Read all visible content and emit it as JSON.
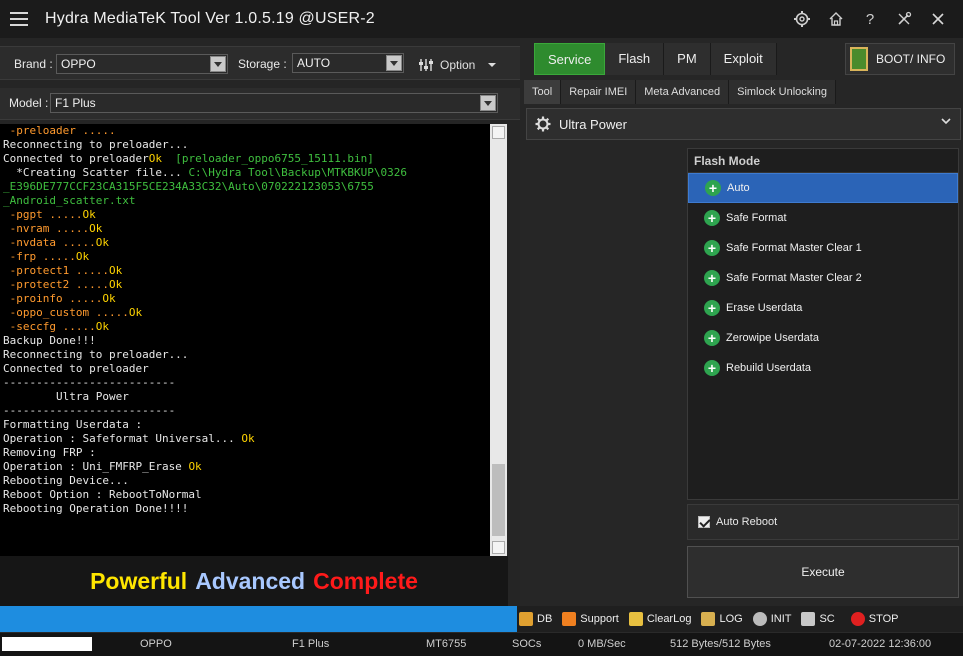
{
  "title": "Hydra MediaTeK Tool  Ver 1.0.5.19 @USER-2",
  "window_icons": [
    "settings-icon",
    "home-icon",
    "help-icon",
    "tools-icon",
    "close-icon"
  ],
  "left": {
    "brand_label": "Brand :",
    "brand_value": "OPPO",
    "storage_label": "Storage :",
    "storage_value": "AUTO",
    "option_label": "Option",
    "model_label": "Model :",
    "model_value": "F1 Plus"
  },
  "console_lines": [
    [
      {
        "t": " -preloader .....",
        "c": "o"
      }
    ],
    [
      {
        "t": "Reconnecting to preloader...",
        "c": "w"
      }
    ],
    [
      {
        "t": "Connected to preloader",
        "c": "w"
      },
      {
        "t": "Ok",
        "c": "y"
      },
      {
        "t": "  [preloader_oppo6755_15111.bin]",
        "c": "g"
      }
    ],
    [
      {
        "t": "  *Creating Scatter file... ",
        "c": "w"
      },
      {
        "t": "C:\\Hydra Tool\\Backup\\MTKBKUP\\0326",
        "c": "g"
      }
    ],
    [
      {
        "t": "_E396DE777CCF23CA315F5CE234A33C32\\Auto\\070222123053\\6755",
        "c": "g"
      }
    ],
    [
      {
        "t": "_Android_scatter.txt",
        "c": "g"
      }
    ],
    [
      {
        "t": " -pgpt .....",
        "c": "o"
      },
      {
        "t": "Ok",
        "c": "y"
      }
    ],
    [
      {
        "t": " -nvram .....",
        "c": "o"
      },
      {
        "t": "Ok",
        "c": "y"
      }
    ],
    [
      {
        "t": " -nvdata .....",
        "c": "o"
      },
      {
        "t": "Ok",
        "c": "y"
      }
    ],
    [
      {
        "t": " -frp .....",
        "c": "o"
      },
      {
        "t": "Ok",
        "c": "y"
      }
    ],
    [
      {
        "t": " -protect1 .....",
        "c": "o"
      },
      {
        "t": "Ok",
        "c": "y"
      }
    ],
    [
      {
        "t": " -protect2 .....",
        "c": "o"
      },
      {
        "t": "Ok",
        "c": "y"
      }
    ],
    [
      {
        "t": " -proinfo .....",
        "c": "o"
      },
      {
        "t": "Ok",
        "c": "y"
      }
    ],
    [
      {
        "t": " -oppo_custom .....",
        "c": "o"
      },
      {
        "t": "Ok",
        "c": "y"
      }
    ],
    [
      {
        "t": " -seccfg .....",
        "c": "o"
      },
      {
        "t": "Ok",
        "c": "y"
      }
    ],
    [
      {
        "t": "Backup Done!!!",
        "c": "w"
      }
    ],
    [
      {
        "t": "Reconnecting to preloader...",
        "c": "w"
      }
    ],
    [
      {
        "t": "Connected to preloader",
        "c": "w"
      }
    ],
    [
      {
        "t": "--------------------------",
        "c": "w"
      }
    ],
    [
      {
        "t": "        Ultra Power",
        "c": "w"
      }
    ],
    [
      {
        "t": "--------------------------",
        "c": "w"
      }
    ],
    [
      {
        "t": "Formatting Userdata :",
        "c": "w"
      }
    ],
    [
      {
        "t": "Operation : Safeformat Universal... ",
        "c": "w"
      },
      {
        "t": "Ok",
        "c": "y"
      }
    ],
    [
      {
        "t": "Removing FRP :",
        "c": "w"
      }
    ],
    [
      {
        "t": "Operation : Uni_FMFRP_Erase ",
        "c": "w"
      },
      {
        "t": "Ok",
        "c": "y"
      }
    ],
    [
      {
        "t": "Rebooting Device...",
        "c": "w"
      }
    ],
    [
      {
        "t": "Reboot Option : RebootToNormal",
        "c": "w"
      }
    ],
    [
      {
        "t": "Rebooting Operation Done!!!!",
        "c": "w"
      }
    ]
  ],
  "banner": {
    "word1": "Powerful",
    "word2": "Advanced",
    "word3": "Complete"
  },
  "right": {
    "main_tabs": [
      "Service",
      "Flash",
      "PM",
      "Exploit"
    ],
    "boot_info": "BOOT/ INFO",
    "sub_tabs": [
      "Tool",
      "Repair IMEI",
      "Meta Advanced",
      "Simlock Unlocking"
    ],
    "mode": "Ultra Power",
    "flash_mode_title": "Flash Mode",
    "flash_items": [
      "Auto",
      "Safe Format",
      "Safe Format Master Clear 1",
      "Safe Format Master Clear 2",
      "Erase Userdata",
      "Zerowipe Userdata",
      "Rebuild Userdata"
    ],
    "auto_reboot_label": "Auto Reboot",
    "execute_label": "Execute"
  },
  "toolbar": {
    "db": "DB",
    "support": "Support",
    "clearlog": "ClearLog",
    "log": "LOG",
    "init": "INIT",
    "sc": "SC",
    "stop": "STOP"
  },
  "status": {
    "brand": "OPPO",
    "model": "F1 Plus",
    "chip": "MT6755",
    "socs": "SOCs",
    "speed": "0 MB/Sec",
    "bytes": "512 Bytes/512 Bytes",
    "datetime": "02-07-2022 12:36:00"
  },
  "colors": {
    "accent_green": "#2e8b2e",
    "selection_blue": "#2b64b7",
    "progress_blue": "#1e8de0",
    "banner_yellow": "#ffe600",
    "banner_blue": "#a8c8ff",
    "banner_red": "#ff1a1a"
  }
}
